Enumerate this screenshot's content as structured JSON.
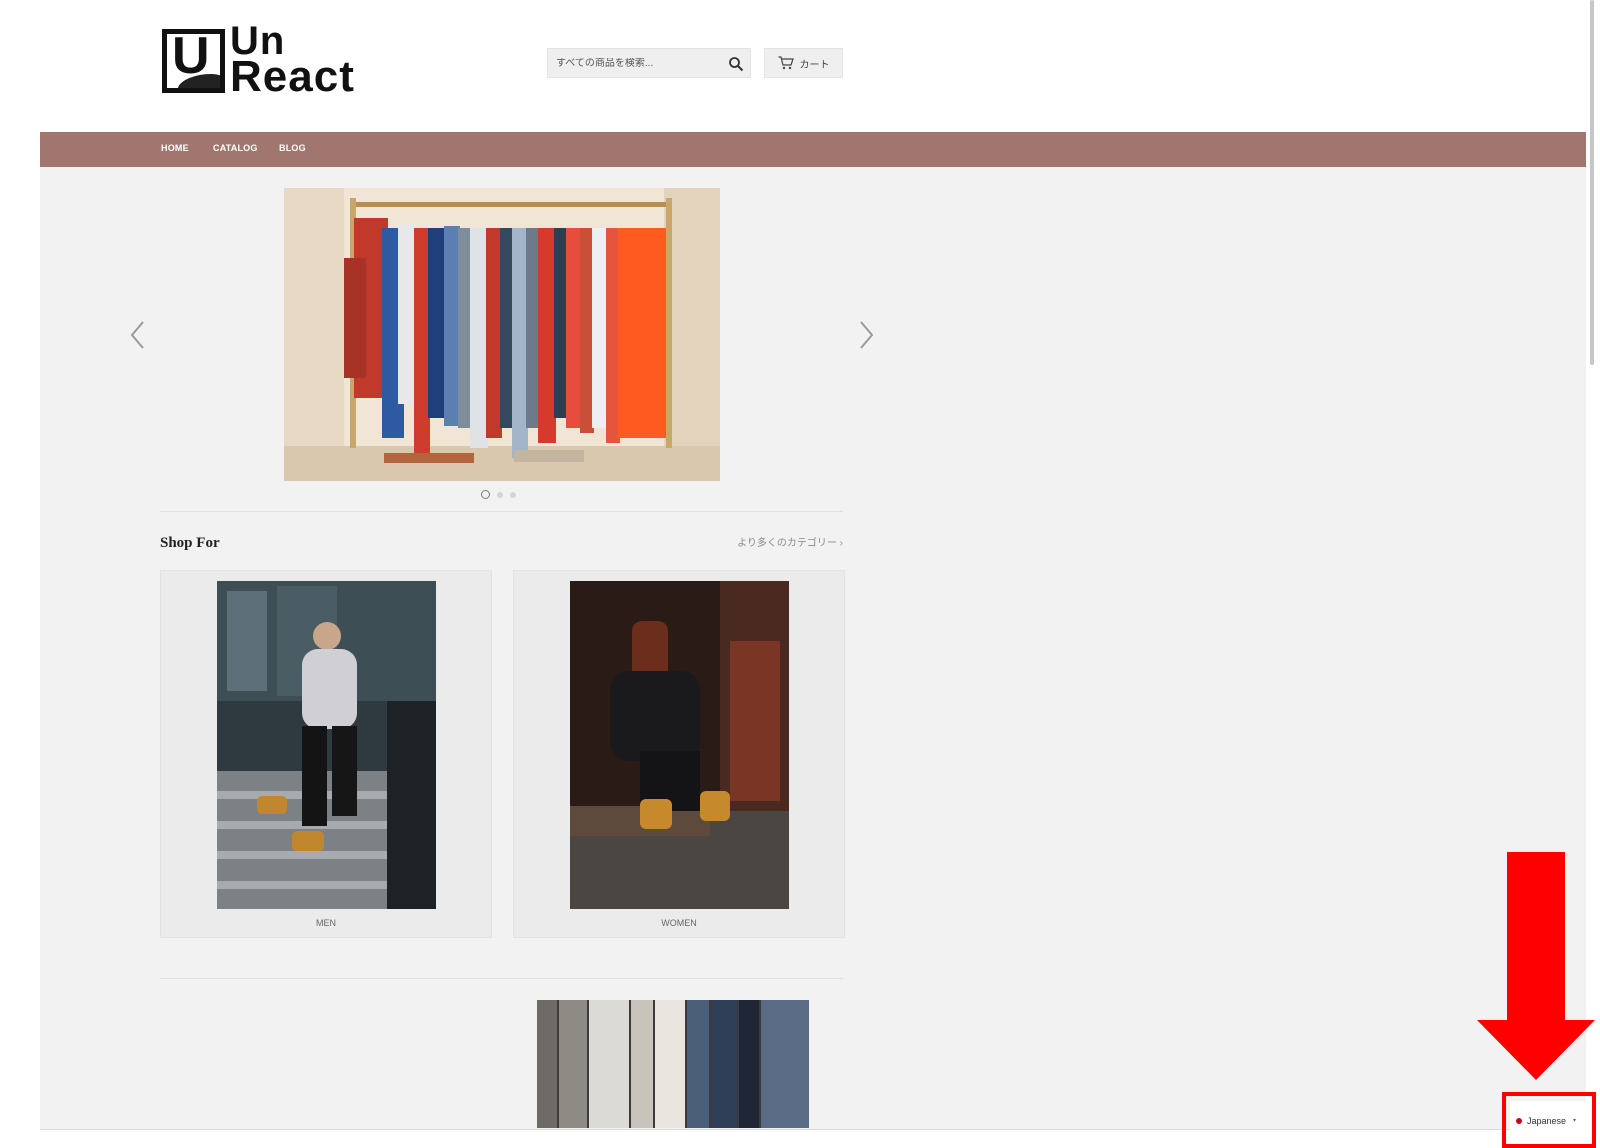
{
  "brand": {
    "logo_text_line1": "Un",
    "logo_text_line2": "React",
    "logo_letter": "U"
  },
  "header": {
    "search_placeholder": "すべての商品を検索...",
    "cart_label": "カート"
  },
  "nav": {
    "items": [
      {
        "label": "HOME"
      },
      {
        "label": "CATALOG"
      },
      {
        "label": "BLOG"
      }
    ]
  },
  "slideshow": {
    "slide_count": 3,
    "active_index": 0
  },
  "shop_for": {
    "title": "Shop For",
    "more_link": "より多くのカテゴリー ›",
    "cards": [
      {
        "label": "MEN"
      },
      {
        "label": "WOMEN"
      }
    ]
  },
  "language_selector": {
    "label": "Japanese"
  },
  "colors": {
    "nav_bar": "#a0766e",
    "page_bg": "#f2f2f2",
    "annotation": "#ff0000"
  },
  "icons": [
    "search-icon",
    "cart-icon",
    "chevron-left-icon",
    "chevron-right-icon",
    "flag-icon",
    "caret-icon",
    "annotation-arrow-icon"
  ]
}
